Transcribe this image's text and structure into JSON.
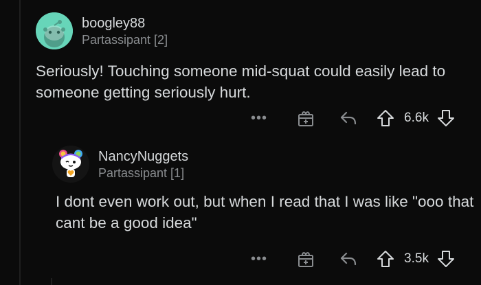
{
  "comments": [
    {
      "username": "boogley88",
      "flair": "Partassipant [2]",
      "body": "Seriously! Touching someone mid-squat could easily lead to someone getting seriously hurt.",
      "score": "6.6k",
      "more_label": "•••",
      "avatar_icon": "snoo-avatar-icon",
      "avatar_color": "#67d5b9"
    },
    {
      "username": "NancyNuggets",
      "flair": "Partassipant [1]",
      "body": "I dont even work out, but when I read that I was like \"ooo that cant be a good idea\"",
      "score": "3.5k",
      "more_label": "•••",
      "avatar_icon": "snoo-avatar-icon"
    }
  ],
  "colors": {
    "background": "#0b0b0b",
    "text": "#d7dadc",
    "muted": "#8a8d90"
  }
}
